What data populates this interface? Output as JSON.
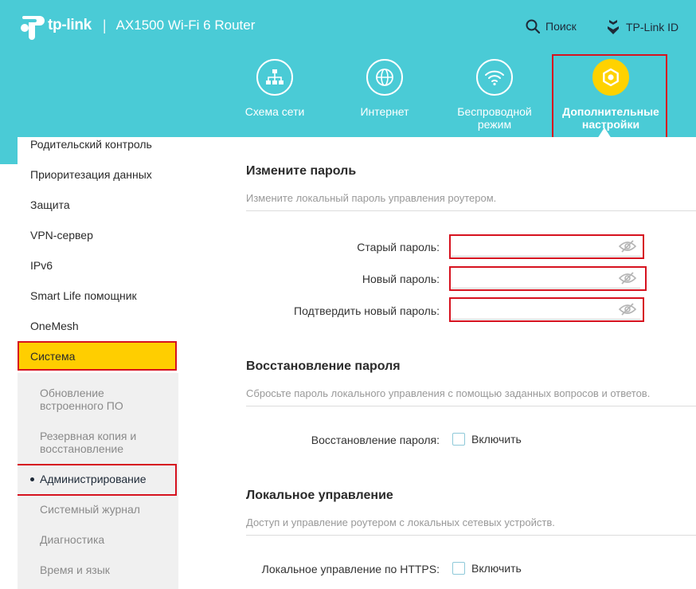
{
  "header": {
    "brand_name": "tp-link",
    "separator": "|",
    "model": "AX1500 Wi-Fi 6 Router",
    "search_label": "Поиск",
    "tplink_id_label": "TP-Link ID",
    "accent_color": "#4acbd6",
    "active_color": "#ffd200"
  },
  "nav": {
    "items": [
      {
        "label": "Схема сети",
        "icon": "network-map-icon"
      },
      {
        "label": "Интернет",
        "icon": "globe-icon"
      },
      {
        "label": "Беспроводной режим",
        "icon": "wifi-icon"
      },
      {
        "label": "Дополнительные настройки",
        "icon": "gear-icon",
        "active": true
      }
    ]
  },
  "sidebar": {
    "items": [
      "Родительский контроль",
      "Приоритезация данных",
      "Защита",
      "VPN-сервер",
      "IPv6",
      "Smart Life помощник",
      "OneMesh"
    ],
    "active": "Система",
    "subitems": [
      "Обновление встроенного ПО",
      "Резервная копия и восстановление",
      "Администрирование",
      "Системный журнал",
      "Диагностика",
      "Время и язык"
    ],
    "current_subitem": "Администрирование"
  },
  "main": {
    "change_password": {
      "title": "Измените пароль",
      "description": "Измените локальный пароль управления роутером.",
      "old_label": "Старый пароль:",
      "new_label": "Новый пароль:",
      "confirm_label": "Подтвердить новый пароль:",
      "old_value": "",
      "new_value": "",
      "confirm_value": ""
    },
    "recovery": {
      "title": "Восстановление пароля",
      "description": "Сбросьте пароль локального управления с помощью заданных вопросов и ответов.",
      "label": "Восстановление пароля:",
      "checkbox_label": "Включить",
      "checked": false
    },
    "local_management": {
      "title": "Локальное управление",
      "description": "Доступ и управление роутером с локальных сетевых устройств.",
      "https_label": "Локальное управление по HTTPS:",
      "checkbox_label": "Включить",
      "checked": false
    }
  }
}
